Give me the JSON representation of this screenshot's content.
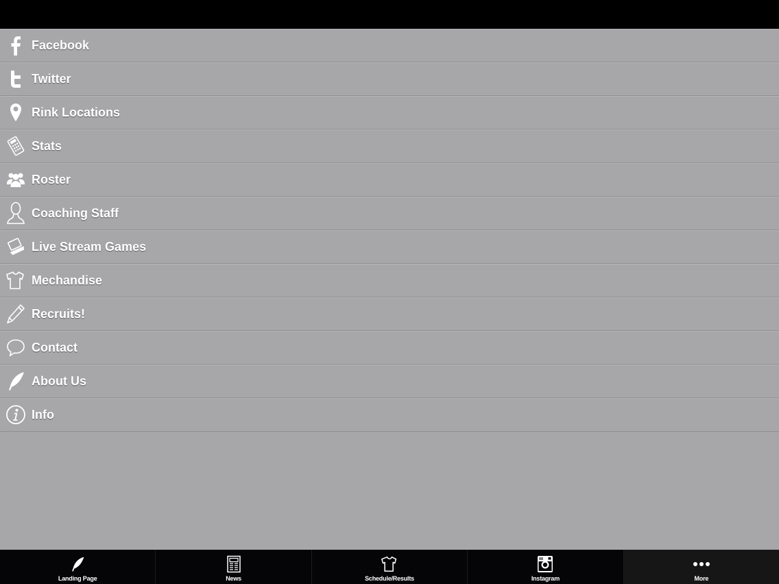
{
  "menu": {
    "items": [
      {
        "label": "Facebook",
        "icon": "facebook-icon"
      },
      {
        "label": "Twitter",
        "icon": "twitter-icon"
      },
      {
        "label": "Rink Locations",
        "icon": "map-pin-icon"
      },
      {
        "label": "Stats",
        "icon": "calculator-icon"
      },
      {
        "label": "Roster",
        "icon": "group-icon"
      },
      {
        "label": "Coaching Staff",
        "icon": "person-icon"
      },
      {
        "label": "Live Stream Games",
        "icon": "laptop-icon"
      },
      {
        "label": "Mechandise",
        "icon": "shirt-icon"
      },
      {
        "label": "Recruits!",
        "icon": "pencil-icon"
      },
      {
        "label": "Contact",
        "icon": "speech-bubble-icon"
      },
      {
        "label": "About Us",
        "icon": "feather-icon"
      },
      {
        "label": "Info",
        "icon": "info-icon"
      }
    ]
  },
  "tabbar": {
    "tabs": [
      {
        "label": "Landing Page",
        "icon": "feather-icon"
      },
      {
        "label": "News",
        "icon": "newspaper-icon"
      },
      {
        "label": "Schedule/Results",
        "icon": "shirt-icon"
      },
      {
        "label": "Instagram",
        "icon": "instagram-icon"
      },
      {
        "label": "More",
        "icon": "more-dots-icon",
        "active": true
      }
    ]
  },
  "colors": {
    "background": "#a7a6a9",
    "top_bar": "#000000",
    "tab_bar": "#050507",
    "text": "#ffffff"
  }
}
